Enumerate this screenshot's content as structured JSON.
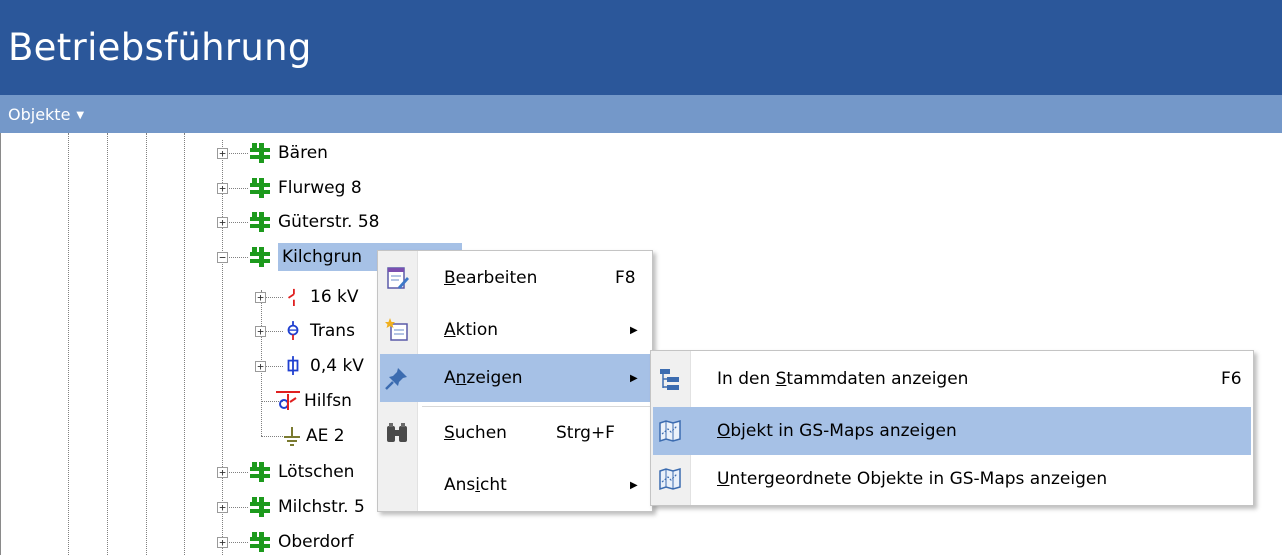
{
  "app": {
    "title": "Betriebsführung",
    "objects_menu": "Objekte"
  },
  "tree": {
    "nodes": [
      {
        "label": "Bären",
        "icon": "green-station-icon"
      },
      {
        "label": "Flurweg 8",
        "icon": "green-station-icon"
      },
      {
        "label": "Güterstr. 58",
        "icon": "green-station-icon"
      },
      {
        "label": "Kilchgrun",
        "icon": "green-station-icon",
        "selected": true
      },
      {
        "label": "16 kV",
        "icon": "switch-icon"
      },
      {
        "label": "Trans",
        "icon": "transformer-icon"
      },
      {
        "label": "0,4 kV",
        "icon": "fuse-icon"
      },
      {
        "label": "Hilfsn",
        "icon": "auxiliary-icon"
      },
      {
        "label": "AE 2",
        "icon": "earthing-icon"
      },
      {
        "label": "Lötschen",
        "icon": "green-station-icon"
      },
      {
        "label": "Milchstr. 5",
        "icon": "green-station-icon"
      },
      {
        "label": "Oberdorf",
        "icon": "green-station-icon"
      }
    ]
  },
  "context_menu": {
    "items": [
      {
        "label_pre": "",
        "mnemonic": "B",
        "label_post": "earbeiten",
        "shortcut": "F8",
        "icon": "edit-form-icon"
      },
      {
        "label_pre": "",
        "mnemonic": "A",
        "label_post": "ktion",
        "shortcut": "",
        "icon": "action-spark-icon",
        "submenu": true
      },
      {
        "label_pre": "A",
        "mnemonic": "n",
        "label_post": "zeigen",
        "shortcut": "",
        "icon": "pin-icon",
        "submenu": true,
        "highlighted": true
      },
      {
        "label_pre": "",
        "mnemonic": "S",
        "label_post": "uchen",
        "shortcut": "Strg+F",
        "icon": "binoculars-icon"
      },
      {
        "label_pre": "Ans",
        "mnemonic": "i",
        "label_post": "cht",
        "shortcut": "",
        "icon": "",
        "submenu": true
      }
    ]
  },
  "submenu": {
    "items": [
      {
        "label_pre": "In den ",
        "mnemonic": "S",
        "label_post": "tammdaten anzeigen",
        "shortcut": "F6",
        "icon": "hierarchy-icon"
      },
      {
        "label_pre": "",
        "mnemonic": "O",
        "label_post": "bjekt in GS-Maps anzeigen",
        "shortcut": "",
        "icon": "map-icon",
        "highlighted": true
      },
      {
        "label_pre": "",
        "mnemonic": "U",
        "label_post": "ntergeordnete Objekte in GS-Maps anzeigen",
        "shortcut": "",
        "icon": "map-icon"
      }
    ]
  },
  "colors": {
    "title_bar": "#2b579a",
    "sub_bar": "#7498c9",
    "selection": "#a6c1e6",
    "station_green": "#1d9a1d"
  }
}
